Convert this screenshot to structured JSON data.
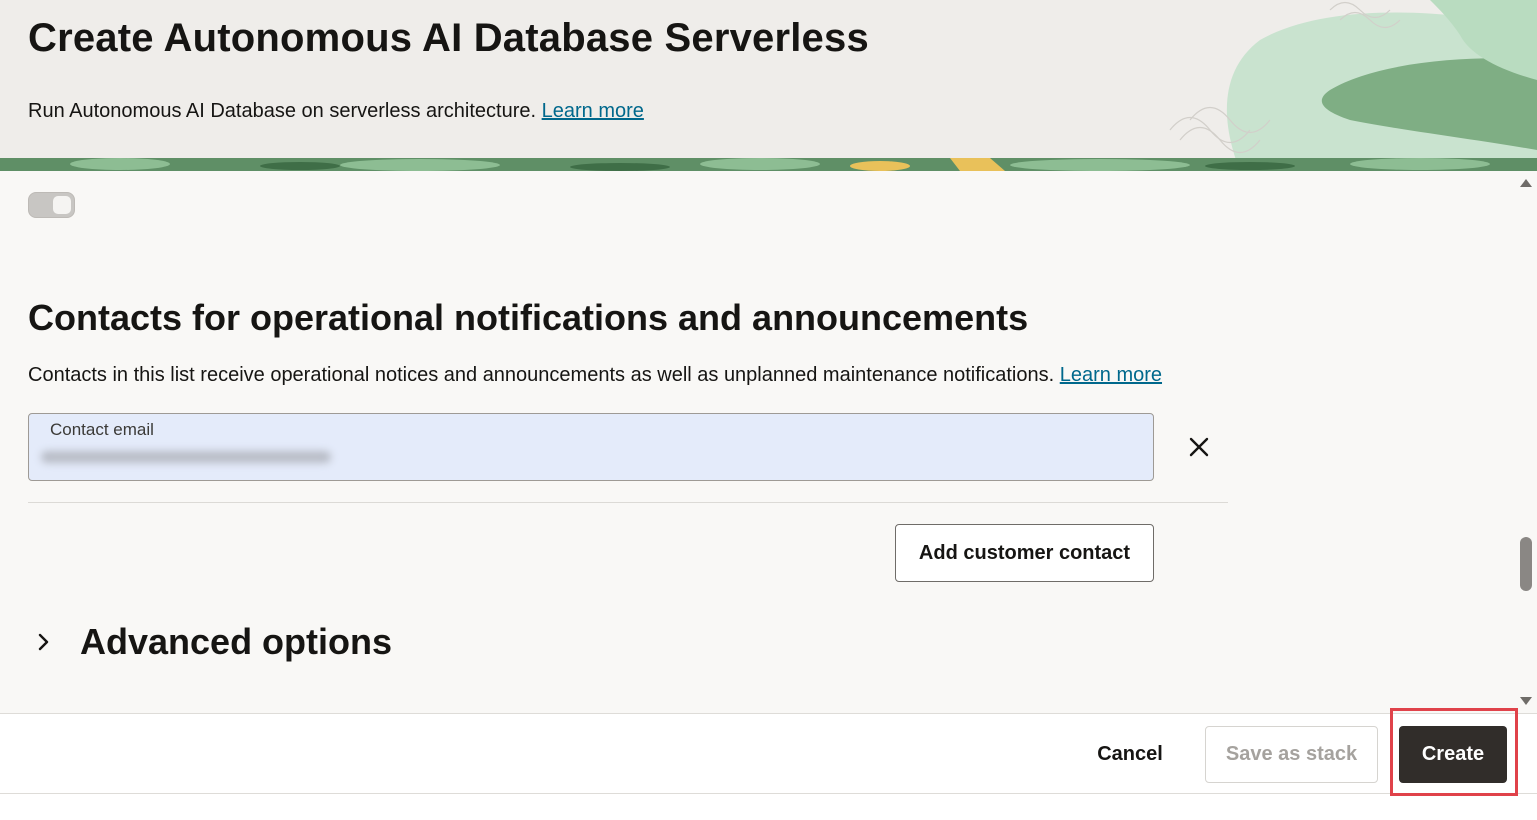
{
  "header": {
    "title": "Create Autonomous AI Database Serverless",
    "subtitle": "Run Autonomous AI Database on serverless architecture.",
    "learn_more": "Learn more"
  },
  "toggle": {
    "state": "off"
  },
  "contacts": {
    "title": "Contacts for operational notifications and announcements",
    "description": "Contacts in this list receive operational notices and announcements as well as unplanned maintenance notifications.",
    "learn_more": "Learn more",
    "email_label": "Contact email",
    "add_button": "Add customer contact"
  },
  "advanced": {
    "title": "Advanced options"
  },
  "footer": {
    "cancel": "Cancel",
    "save_as_stack": "Save as stack",
    "create": "Create"
  },
  "colors": {
    "accent_link": "#00688c",
    "primary_button": "#312d2a",
    "highlight": "#e0424a",
    "email_field_bg": "#e4ebfa"
  },
  "icons": {
    "remove": "close-icon",
    "expand": "chevron-right-icon",
    "scroll_up": "triangle-up-icon",
    "scroll_down": "triangle-down-icon"
  }
}
